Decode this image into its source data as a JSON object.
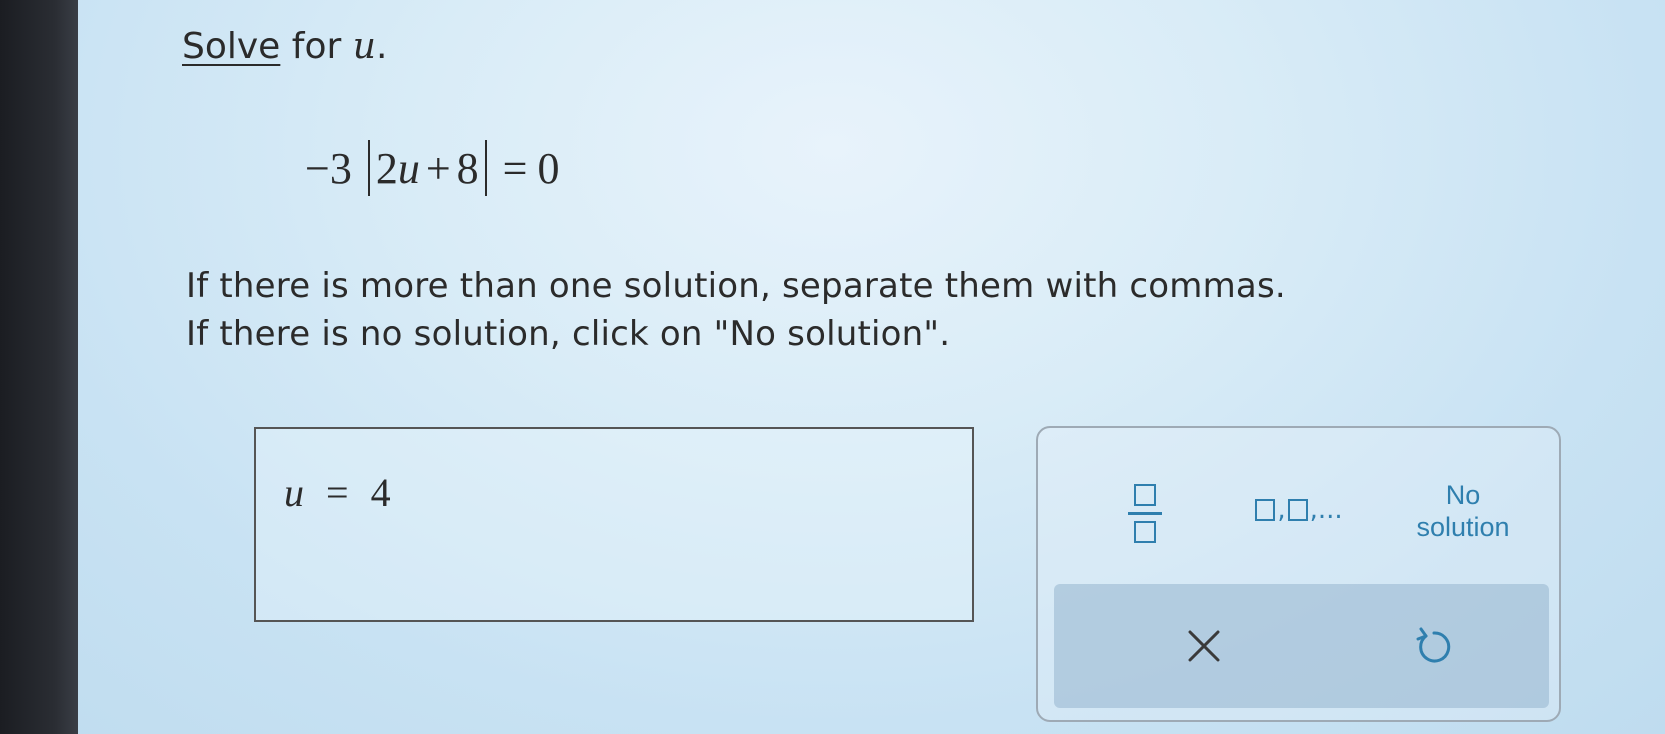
{
  "prompt": {
    "link_text": "Solve",
    "rest_text": "for",
    "variable": "u",
    "period": "."
  },
  "equation": {
    "coefficient": "−3",
    "inner_coef": "2",
    "inner_var": "u",
    "plus": "+",
    "inner_const": "8",
    "equals": "=",
    "rhs": "0"
  },
  "instructions": {
    "line1": "If there is more than one solution, separate them with commas.",
    "line2": "If there is no solution, click on \"No solution\"."
  },
  "answer": {
    "variable": "u",
    "equals": "=",
    "value": "4"
  },
  "keypad": {
    "fraction_icon": "fraction-template-icon",
    "list_icon": "comma-list-template-icon",
    "list_suffix": ",...",
    "list_comma": ",",
    "no_solution_line1": "No",
    "no_solution_line2": "solution",
    "clear_symbol": "✕",
    "undo_symbol": "↺",
    "accent_color": "#2f7fae"
  }
}
